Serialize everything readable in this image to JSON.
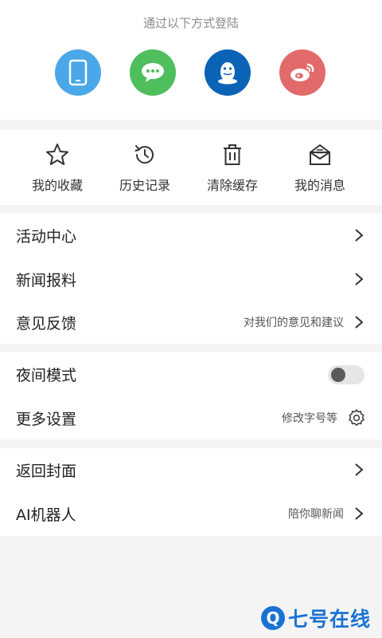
{
  "login": {
    "title": "通过以下方式登陆",
    "methods": [
      {
        "icon": "phone-icon",
        "color": "#4aa7e8"
      },
      {
        "icon": "wechat-icon",
        "color": "#4fbe5d"
      },
      {
        "icon": "qq-icon",
        "color": "#0b63b6"
      },
      {
        "icon": "weibo-icon",
        "color": "#e26a6a"
      }
    ]
  },
  "quick_actions": [
    {
      "label": "我的收藏",
      "icon": "star-icon"
    },
    {
      "label": "历史记录",
      "icon": "history-icon"
    },
    {
      "label": "清除缓存",
      "icon": "trash-icon"
    },
    {
      "label": "我的消息",
      "icon": "mail-icon"
    }
  ],
  "menu": {
    "activity": {
      "label": "活动中心"
    },
    "news_tip": {
      "label": "新闻报料"
    },
    "feedback": {
      "label": "意见反馈",
      "hint": "对我们的意见和建议"
    },
    "night_mode": {
      "label": "夜间模式",
      "enabled": false
    },
    "more_settings": {
      "label": "更多设置",
      "hint": "修改字号等"
    },
    "back_cover": {
      "label": "返回封面"
    },
    "ai_robot": {
      "label": "AI机器人",
      "hint": "陪你聊新闻"
    }
  },
  "watermark": {
    "text": "七号在线",
    "letter": "Q",
    "color": "#1a73d4"
  }
}
